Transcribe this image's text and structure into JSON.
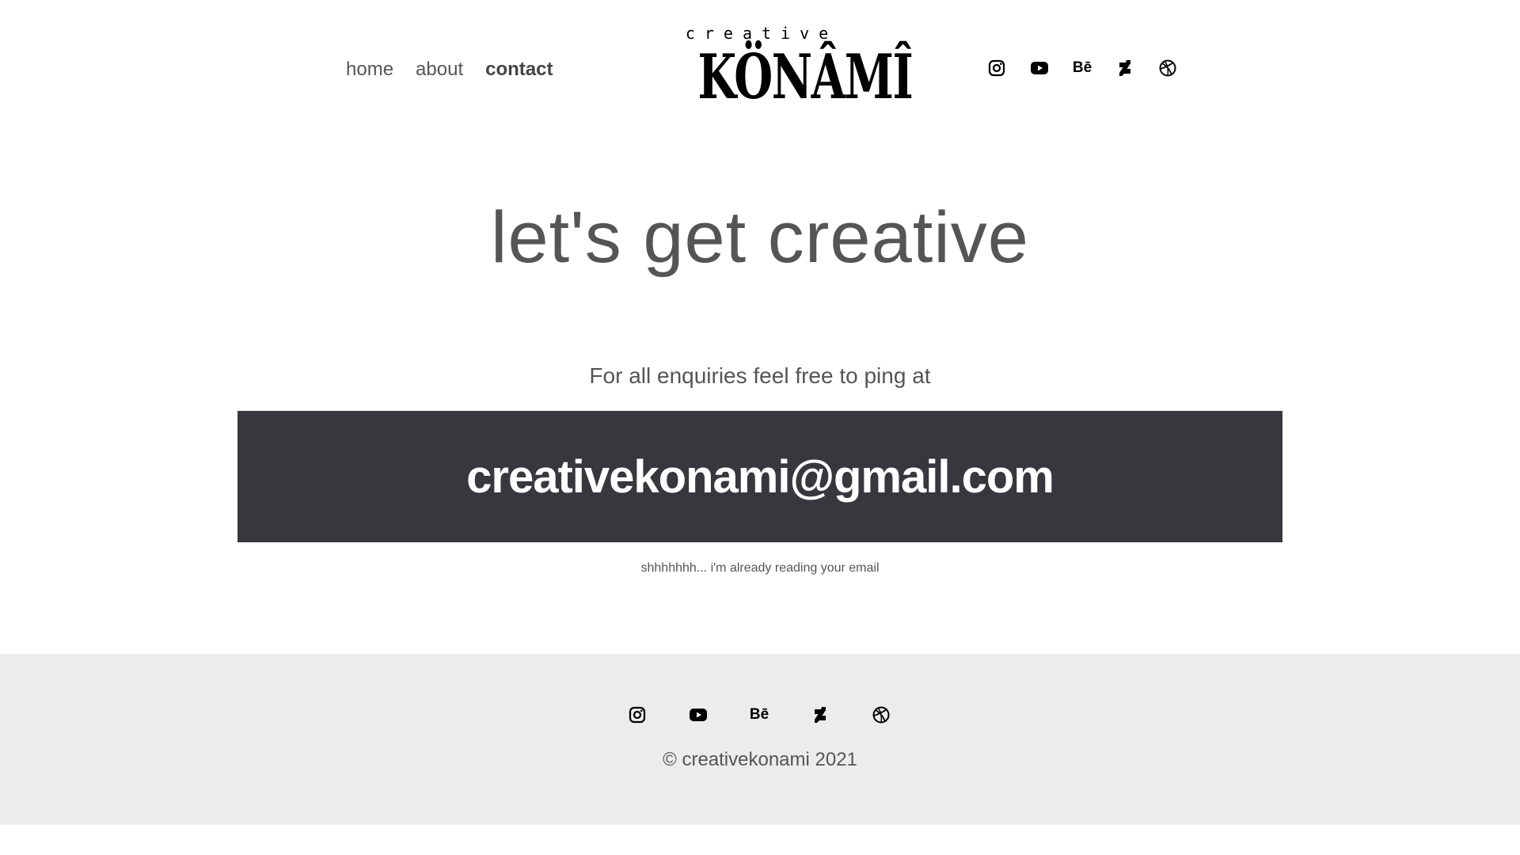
{
  "nav": {
    "items": [
      {
        "label": "home",
        "active": false
      },
      {
        "label": "about",
        "active": false
      },
      {
        "label": "contact",
        "active": true
      }
    ]
  },
  "logo": {
    "top_text": "creative",
    "main_text": "KÖNÂMÎ"
  },
  "social": {
    "icons": [
      "instagram-icon",
      "youtube-icon",
      "behance-icon",
      "deviantart-icon",
      "dribbble-icon"
    ],
    "behance_text": "Bē"
  },
  "main": {
    "title": "let's get creative",
    "intro": "For all enquiries feel free to ping at",
    "email": "creativekonami@gmail.com",
    "note": "shhhhhhh... i'm already reading your email"
  },
  "footer": {
    "copyright": "© creativekonami 2021"
  },
  "colors": {
    "email_box_bg": "#37383d",
    "footer_bg": "#ececec",
    "text": "#555555"
  }
}
